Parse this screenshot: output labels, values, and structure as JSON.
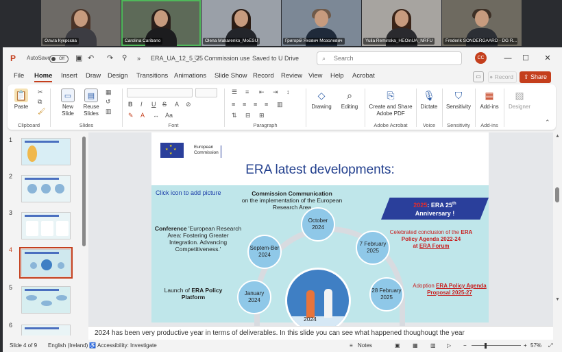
{
  "video_tiles": [
    {
      "name": "Ольга Кукрєєва"
    },
    {
      "name": "Carolina Caribano"
    },
    {
      "name": "Olena Makarenko_MoESU"
    },
    {
      "name": "Григорій Якович Мозолевич"
    },
    {
      "name": "Yulia Reminska_HEOinUA_NRFU"
    },
    {
      "name": "Frederik SONDERGAARD - DG R..."
    }
  ],
  "titlebar": {
    "autosave_label": "AutoSave",
    "autosave_state": "Off",
    "filename": "ERA_UA_12_5_25",
    "sensitivity": "Commission use",
    "saved": "Saved to U Drive",
    "search_placeholder": "Search",
    "avatar_initials": "CC",
    "minimize": "—",
    "maximize": "☐",
    "close": "✕"
  },
  "menu_tabs": [
    "File",
    "Home",
    "Insert",
    "Draw",
    "Design",
    "Transitions",
    "Animations",
    "Slide Show",
    "Record",
    "Review",
    "View",
    "Help",
    "Acrobat"
  ],
  "selected_tab": "Home",
  "record_button": "Record",
  "share_button": "Share",
  "ribbon": {
    "clipboard": {
      "label": "Clipboard",
      "paste": "Paste"
    },
    "slides": {
      "label": "Slides",
      "new_slide": "New Slide",
      "reuse_slides": "Reuse Slides"
    },
    "font": {
      "label": "Font",
      "bold": "B",
      "italic": "I",
      "underline": "U",
      "strike": "S",
      "grow": "A"
    },
    "paragraph": {
      "label": "Paragraph"
    },
    "drawing": {
      "label": "Drawing"
    },
    "editing": {
      "label": "Editing"
    },
    "adobe": {
      "label": "Adobe Acrobat",
      "create_share": "Create and Share Adobe PDF"
    },
    "voice": {
      "label": "Voice",
      "dictate": "Dictate"
    },
    "sensitivity": {
      "label": "Sensitivity",
      "button": "Sensitivity"
    },
    "addins": {
      "label": "Add-ins",
      "button": "Add-ins"
    },
    "designer": {
      "button": "Designer"
    }
  },
  "thumbnails": [
    {
      "num": "1",
      "selected": false
    },
    {
      "num": "2",
      "selected": false
    },
    {
      "num": "3",
      "selected": false
    },
    {
      "num": "4",
      "selected": true
    },
    {
      "num": "5",
      "selected": false
    },
    {
      "num": "6",
      "selected": false
    }
  ],
  "slide": {
    "eu_text_line1": "European",
    "eu_text_line2": "Commission",
    "title": "ERA latest developments:",
    "placeholder": "Click icon to add picture",
    "commission_comm_title": "Commission Communication",
    "commission_comm_body": "on the implementation of the European Research Area",
    "anniv_year": "2025",
    "anniv_text": ": ERA 25",
    "anniv_sup": "th",
    "anniv_line2": "Anniversary !",
    "conference_title": "Conference",
    "conference_body": "'European Research Area: Fostering Greater Integration. Advancing Competitiveness.'",
    "launch_pre": "Launch of ",
    "launch_bold": "ERA Policy Platform",
    "celebrated_pre": "Celebrated conclusion of the ",
    "celebrated_bold": "ERA Policy Agenda 2022-24",
    "celebrated_at": "at ",
    "celebrated_forum": "ERA Forum",
    "adoption_pre": "Adoption ",
    "adoption_bold": "ERA Policy Agenda Proposal 2025-27",
    "bubble_oct": "October 2024",
    "bubble_sep": "Septem-Ber 2024",
    "bubble_feb7": "7 February 2025",
    "bubble_jan": "January 2024",
    "bubble_feb28": "28 February 2025",
    "year_label": "2024"
  },
  "notes": "2024 has been very productive year in terms of deliverables. In this slide you can see what happened thoughougt the year",
  "status": {
    "slide_info": "Slide 4 of 9",
    "language": "English (Ireland)",
    "accessibility": "Accessibility: Investigate",
    "notes_btn": "Notes",
    "zoom": "57%"
  }
}
